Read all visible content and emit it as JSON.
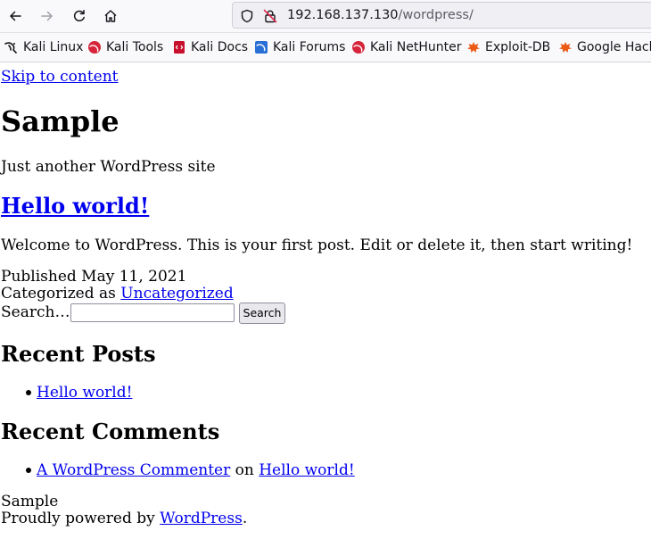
{
  "browser": {
    "url_host": "192.168.137.130",
    "url_path": "/wordpress/",
    "bookmarks": [
      {
        "label": "Kali Linux",
        "icon": "kali-dragon-icon"
      },
      {
        "label": "Kali Tools",
        "icon": "kali-tools-icon"
      },
      {
        "label": "Kali Docs",
        "icon": "kali-docs-icon"
      },
      {
        "label": "Kali Forums",
        "icon": "kali-forums-icon"
      },
      {
        "label": "Kali NetHunter",
        "icon": "kali-nethunter-icon"
      },
      {
        "label": "Exploit-DB",
        "icon": "exploit-db-icon"
      },
      {
        "label": "Google Hack",
        "icon": "google-hacking-icon"
      }
    ]
  },
  "page": {
    "skip_link": "Skip to content",
    "site_title": "Sample",
    "site_description": "Just another WordPress site",
    "post": {
      "title": "Hello world!",
      "excerpt": "Welcome to WordPress. This is your first post. Edit or delete it, then start writing!",
      "published": "Published May 11, 2021",
      "categorized_prefix": "Categorized as ",
      "category": "Uncategorized"
    },
    "search": {
      "label": "Search…",
      "value": "",
      "button": "Search"
    },
    "recent_posts": {
      "heading": "Recent Posts",
      "items": [
        "Hello world!"
      ]
    },
    "recent_comments": {
      "heading": "Recent Comments",
      "author": "A WordPress Commenter",
      "on": " on ",
      "post": "Hello world!"
    },
    "footer": {
      "site": "Sample",
      "powered_prefix": "Proudly powered by ",
      "powered_link": "WordPress",
      "powered_suffix": "."
    }
  }
}
